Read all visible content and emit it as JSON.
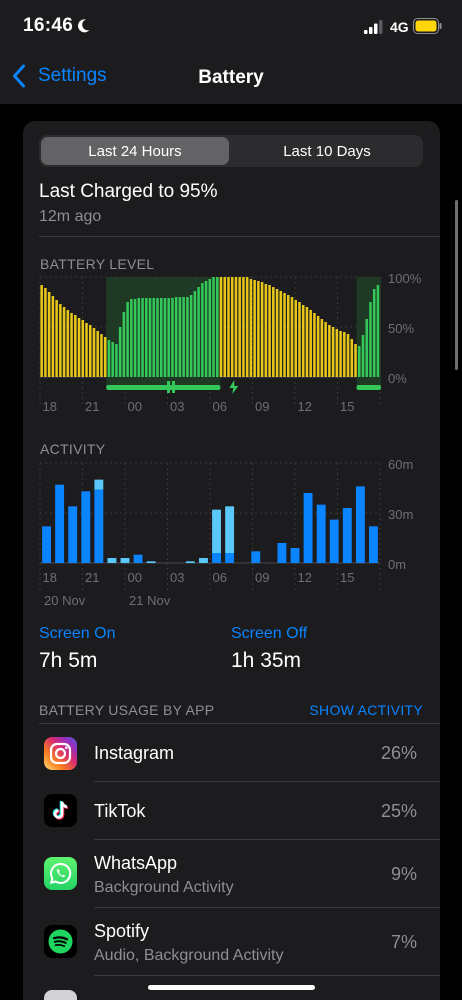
{
  "status_bar": {
    "time": "16:46",
    "network": "4G",
    "battery_color": "#ffd60a"
  },
  "nav": {
    "back_label": "Settings",
    "title": "Battery"
  },
  "segmented": {
    "option_1": "Last 24 Hours",
    "option_2": "Last 10 Days",
    "selected": "Last 24 Hours"
  },
  "last_charged": {
    "title": "Last Charged to 95%",
    "subtitle": "12m ago"
  },
  "battery_chart": {
    "label": "BATTERY LEVEL",
    "y_ticks": [
      "100%",
      "50%",
      "0%"
    ],
    "x_ticks": [
      "18",
      "21",
      "00",
      "03",
      "06",
      "09",
      "12",
      "15"
    ]
  },
  "activity_chart": {
    "label": "ACTIVITY",
    "y_ticks": [
      "60m",
      "30m",
      "0m"
    ],
    "x_ticks": [
      "18",
      "21",
      "00",
      "03",
      "06",
      "09",
      "12",
      "15"
    ],
    "date_labels": [
      "20 Nov",
      "21 Nov"
    ]
  },
  "chart_data": [
    {
      "type": "bar",
      "title": "BATTERY LEVEL",
      "unit": "%",
      "ylim": [
        0,
        100
      ],
      "y_ticks": [
        "100%",
        "50%",
        "0%"
      ],
      "x_ticks": [
        "18",
        "21",
        "00",
        "03",
        "06",
        "09",
        "12",
        "15"
      ],
      "values": [
        92,
        89,
        85,
        81,
        77,
        73,
        70,
        67,
        64,
        62,
        59,
        57,
        54,
        52,
        49,
        46,
        43,
        40,
        37,
        35,
        33,
        50,
        65,
        75,
        78,
        78,
        79,
        79,
        79,
        79,
        79,
        79,
        79,
        79,
        79,
        79,
        80,
        80,
        80,
        80,
        82,
        86,
        90,
        94,
        96,
        98,
        100,
        100,
        100,
        100,
        100,
        100,
        100,
        100,
        100,
        100,
        98,
        97,
        96,
        95,
        93,
        92,
        90,
        88,
        86,
        84,
        82,
        80,
        77,
        75,
        72,
        70,
        67,
        64,
        61,
        58,
        55,
        52,
        50,
        48,
        46,
        45,
        43,
        38,
        33,
        31,
        42,
        58,
        75,
        88,
        92
      ],
      "charging": [
        0,
        0,
        0,
        0,
        0,
        0,
        0,
        0,
        0,
        0,
        0,
        0,
        0,
        0,
        0,
        0,
        0,
        0,
        1,
        1,
        1,
        1,
        1,
        1,
        1,
        1,
        1,
        1,
        1,
        1,
        1,
        1,
        1,
        1,
        1,
        1,
        1,
        1,
        1,
        1,
        1,
        1,
        1,
        1,
        1,
        1,
        1,
        1,
        0,
        0,
        0,
        0,
        0,
        0,
        0,
        0,
        0,
        0,
        0,
        0,
        0,
        0,
        0,
        0,
        0,
        0,
        0,
        0,
        0,
        0,
        0,
        0,
        0,
        0,
        0,
        0,
        0,
        0,
        0,
        0,
        0,
        0,
        0,
        0,
        0,
        1,
        1,
        1,
        1,
        1,
        1
      ],
      "colors": {
        "discharging": "#e6c619",
        "charging": "#34c759"
      }
    },
    {
      "type": "bar",
      "title": "ACTIVITY",
      "unit": "minutes",
      "ylim": [
        0,
        60
      ],
      "y_ticks": [
        "60m",
        "30m",
        "0m"
      ],
      "x_ticks": [
        "18",
        "21",
        "00",
        "03",
        "06",
        "09",
        "12",
        "15"
      ],
      "series": [
        {
          "name": "Screen On",
          "color": "#0a84ff",
          "values": [
            22,
            47,
            34,
            43,
            44,
            0,
            0,
            5,
            0,
            0,
            0,
            0,
            0,
            6,
            6,
            0,
            7,
            0,
            12,
            9,
            42,
            35,
            26,
            33,
            46,
            22
          ]
        },
        {
          "name": "Screen Off",
          "color": "#5ac8fa",
          "values": [
            0,
            0,
            0,
            0,
            6,
            3,
            3,
            0,
            1,
            0,
            0,
            1,
            3,
            26,
            28,
            0,
            0,
            0,
            0,
            0,
            0,
            0,
            0,
            0,
            0,
            0
          ]
        }
      ]
    }
  ],
  "screen_time": {
    "on_label": "Screen On",
    "on_value": "7h 5m",
    "off_label": "Screen Off",
    "off_value": "1h 35m"
  },
  "usage": {
    "header": "BATTERY USAGE BY APP",
    "show_activity": "SHOW ACTIVITY",
    "apps": [
      {
        "name": "Instagram",
        "subtitle": "",
        "percent": "26%",
        "icon": "instagram-icon"
      },
      {
        "name": "TikTok",
        "subtitle": "",
        "percent": "25%",
        "icon": "tiktok-icon"
      },
      {
        "name": "WhatsApp",
        "subtitle": "Background Activity",
        "percent": "9%",
        "icon": "whatsapp-icon"
      },
      {
        "name": "Spotify",
        "subtitle": "Audio, Background Activity",
        "percent": "7%",
        "icon": "spotify-icon"
      }
    ]
  }
}
